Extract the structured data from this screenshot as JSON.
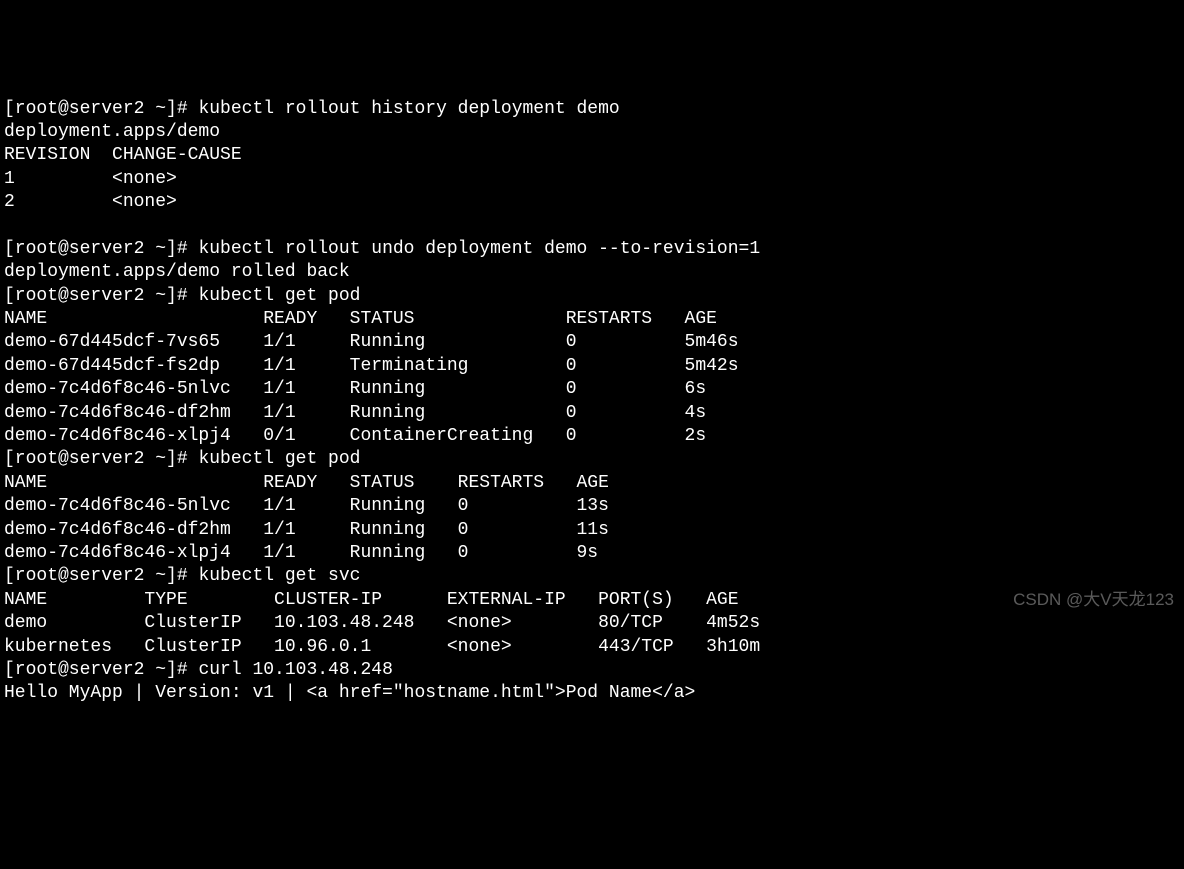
{
  "prompt": "[root@server2 ~]# ",
  "cmd1": "kubectl rollout history deployment demo",
  "out1_line1": "deployment.apps/demo",
  "out1_header": "REVISION  CHANGE-CAUSE",
  "out1_rows": [
    "1         <none>",
    "2         <none>"
  ],
  "cmd2": "kubectl rollout undo deployment demo --to-revision=1",
  "out2_line1": "deployment.apps/demo rolled back",
  "cmd3": "kubectl get pod",
  "pods1_header": "NAME                    READY   STATUS              RESTARTS   AGE",
  "pods1_rows": [
    "demo-67d445dcf-7vs65    1/1     Running             0          5m46s",
    "demo-67d445dcf-fs2dp    1/1     Terminating         0          5m42s",
    "demo-7c4d6f8c46-5nlvc   1/1     Running             0          6s",
    "demo-7c4d6f8c46-df2hm   1/1     Running             0          4s",
    "demo-7c4d6f8c46-xlpj4   0/1     ContainerCreating   0          2s"
  ],
  "cmd4": "kubectl get pod",
  "pods2_header": "NAME                    READY   STATUS    RESTARTS   AGE",
  "pods2_rows": [
    "demo-7c4d6f8c46-5nlvc   1/1     Running   0          13s",
    "demo-7c4d6f8c46-df2hm   1/1     Running   0          11s",
    "demo-7c4d6f8c46-xlpj4   1/1     Running   0          9s"
  ],
  "cmd5": "kubectl get svc",
  "svc_header": "NAME         TYPE        CLUSTER-IP      EXTERNAL-IP   PORT(S)   AGE",
  "svc_rows": [
    "demo         ClusterIP   10.103.48.248   <none>        80/TCP    4m52s",
    "kubernetes   ClusterIP   10.96.0.1       <none>        443/TCP   3h10m"
  ],
  "cmd6": "curl 10.103.48.248",
  "curl_out": "Hello MyApp | Version: v1 | <a href=\"hostname.html\">Pod Name</a>",
  "watermark": "CSDN @大V天龙123"
}
